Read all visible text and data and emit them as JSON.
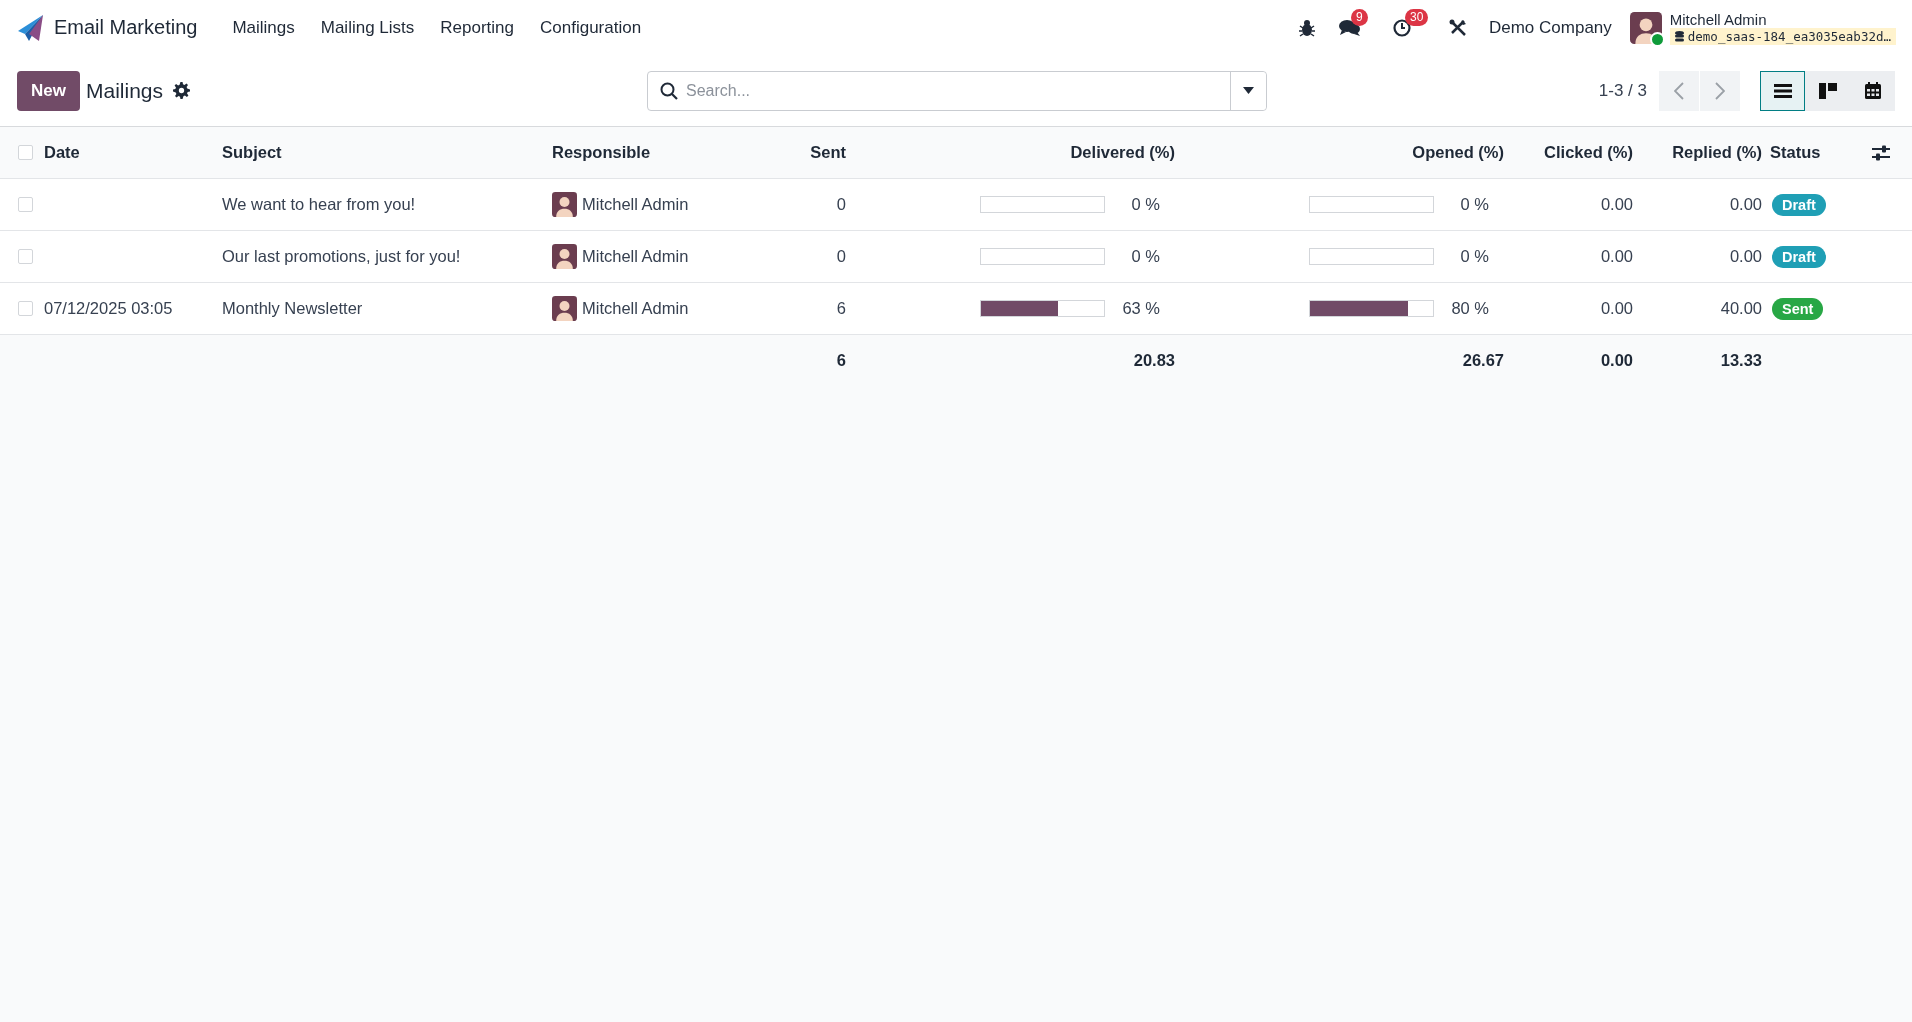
{
  "navbar": {
    "app_name": "Email Marketing",
    "menu": [
      "Mailings",
      "Mailing Lists",
      "Reporting",
      "Configuration"
    ],
    "systray": {
      "messages_count": "9",
      "activities_count": "30",
      "company": "Demo Company",
      "user_name": "Mitchell Admin",
      "database": "demo_saas-184_ea3035eab32d…"
    }
  },
  "control_panel": {
    "new_button": "New",
    "breadcrumb": "Mailings",
    "search": {
      "placeholder": "Search..."
    },
    "pager": "1-3 / 3",
    "views": [
      {
        "kind": "list",
        "selected": true
      },
      {
        "kind": "kanban",
        "selected": false
      },
      {
        "kind": "calendar",
        "selected": false
      }
    ]
  },
  "table": {
    "select_all": {
      "checked": false
    },
    "columns": [
      "Date",
      "Subject",
      "Responsible",
      "Sent",
      "Delivered (%)",
      "Opened (%)",
      "Clicked (%)",
      "Replied (%)",
      "Status"
    ],
    "rows": [
      {
        "selected": false,
        "date": "",
        "subject": "We want to hear from you!",
        "responsible": "Mitchell Admin",
        "sent": "0",
        "delivered": {
          "level": 0,
          "reading": "0 %"
        },
        "opened": {
          "level": 0,
          "reading": "0 %"
        },
        "clicked": "0.00",
        "replied": "0.00",
        "status": {
          "label": "Draft",
          "color": "#1f9fb5"
        }
      },
      {
        "selected": false,
        "date": "",
        "subject": "Our last promotions, just for you!",
        "responsible": "Mitchell Admin",
        "sent": "0",
        "delivered": {
          "level": 0,
          "reading": "0 %"
        },
        "opened": {
          "level": 0,
          "reading": "0 %"
        },
        "clicked": "0.00",
        "replied": "0.00",
        "status": {
          "label": "Draft",
          "color": "#1f9fb5"
        }
      },
      {
        "selected": false,
        "date": "07/12/2025 03:05",
        "subject": "Monthly Newsletter",
        "responsible": "Mitchell Admin",
        "sent": "6",
        "delivered": {
          "level": 0.63,
          "reading": "63 %"
        },
        "opened": {
          "level": 0.8,
          "reading": "80 %"
        },
        "clicked": "0.00",
        "replied": "40.00",
        "status": {
          "label": "Sent",
          "color": "#28a745"
        }
      }
    ],
    "totals": {
      "sent": "6",
      "delivered": "20.83",
      "opened": "26.67",
      "clicked": "0.00",
      "replied": "13.33"
    }
  }
}
